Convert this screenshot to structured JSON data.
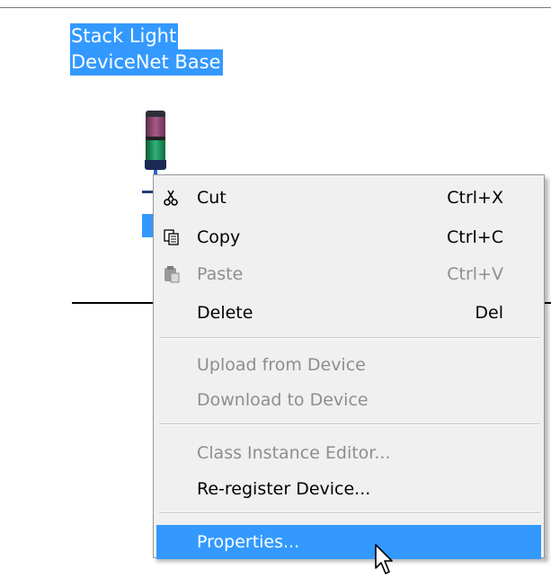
{
  "device": {
    "label_line1": "Stack Light",
    "label_line2": "DeviceNet Base"
  },
  "context_menu": {
    "items": [
      {
        "label": "Cut",
        "shortcut": "Ctrl+X",
        "icon": "scissors-icon",
        "enabled": true
      },
      {
        "label": "Copy",
        "shortcut": "Ctrl+C",
        "icon": "copy-icon",
        "enabled": true
      },
      {
        "label": "Paste",
        "shortcut": "Ctrl+V",
        "icon": "paste-icon",
        "enabled": false
      },
      {
        "label": "Delete",
        "shortcut": "Del",
        "enabled": true
      },
      {
        "label": "Upload from Device",
        "enabled": false
      },
      {
        "label": "Download to Device",
        "enabled": false
      },
      {
        "label": "Class Instance Editor...",
        "enabled": false
      },
      {
        "label": "Re-register Device...",
        "enabled": true
      },
      {
        "label": "Properties...",
        "enabled": true,
        "highlighted": true
      }
    ]
  },
  "colors": {
    "selection": "#3399ff",
    "menu_background": "#f0f0f0",
    "disabled_text": "#8e8e8e"
  }
}
